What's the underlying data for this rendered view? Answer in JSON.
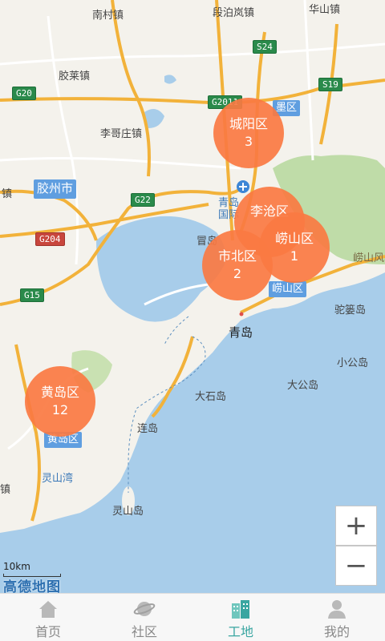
{
  "map": {
    "places": [
      {
        "id": "nancun",
        "name": "南村镇"
      },
      {
        "id": "duanbo",
        "name": "段泊岚镇"
      },
      {
        "id": "huashan",
        "name": "华山镇"
      },
      {
        "id": "jiaolai",
        "name": "胶莱镇"
      },
      {
        "id": "ligezhuang",
        "name": "李哥庄镇"
      },
      {
        "id": "zhen_left",
        "name": "镇"
      },
      {
        "id": "qingdao_airport",
        "name": "青岛 国际"
      },
      {
        "id": "mao",
        "name": "冒岛"
      },
      {
        "id": "laoshanfeng",
        "name": "崂山风"
      },
      {
        "id": "qingdao",
        "name": "青岛"
      },
      {
        "id": "tuoluodao",
        "name": "驼篓岛"
      },
      {
        "id": "xiaogongdao",
        "name": "小公岛"
      },
      {
        "id": "dagongdao",
        "name": "大公岛"
      },
      {
        "id": "dashidao",
        "name": "大石岛"
      },
      {
        "id": "liandao",
        "name": "连岛"
      },
      {
        "id": "lingshanwan",
        "name": "灵山湾"
      },
      {
        "id": "lingshandao",
        "name": "灵山岛"
      },
      {
        "id": "zhen_left2",
        "name": "镇"
      }
    ],
    "district_tags": [
      {
        "id": "jiaozhou",
        "name": "胶州市"
      },
      {
        "id": "huangdao_tag",
        "name": "黄岛区"
      },
      {
        "id": "laoshan_tag",
        "name": "崂山区"
      },
      {
        "id": "jimo_tag",
        "name": "墨区"
      }
    ],
    "road_shields": [
      {
        "id": "s24",
        "name": "S24",
        "color": "green"
      },
      {
        "id": "g20",
        "name": "G20",
        "color": "green"
      },
      {
        "id": "s19",
        "name": "S19",
        "color": "green"
      },
      {
        "id": "g2011",
        "name": "G2011",
        "color": "green"
      },
      {
        "id": "g22",
        "name": "G22",
        "color": "green"
      },
      {
        "id": "g204",
        "name": "G204",
        "color": "red"
      },
      {
        "id": "g15",
        "name": "G15",
        "color": "green"
      }
    ],
    "clusters": [
      {
        "id": "chengyang",
        "name": "城阳区",
        "count": "3"
      },
      {
        "id": "licang",
        "name": "李沧区",
        "count": ""
      },
      {
        "id": "shibei",
        "name": "市北区",
        "count": "2"
      },
      {
        "id": "laoshan",
        "name": "崂山区",
        "count": "1"
      },
      {
        "id": "huangdao",
        "name": "黄岛区",
        "count": "12"
      }
    ],
    "zoom_in": "+",
    "zoom_out": "−",
    "scale_label": "10km",
    "logo_text": "高德地图",
    "colors": {
      "cluster": "#fa7a42",
      "sea": "#a8cdea",
      "land": "#f4f2ec",
      "road_orange": "#f2b23a",
      "road_white": "#ffffff",
      "park": "#bfdca8"
    }
  },
  "tabbar": {
    "active": "worksite",
    "tabs": [
      {
        "id": "home",
        "label": "首页",
        "icon": "home-icon"
      },
      {
        "id": "community",
        "label": "社区",
        "icon": "planet-icon"
      },
      {
        "id": "worksite",
        "label": "工地",
        "icon": "buildings-icon"
      },
      {
        "id": "mine",
        "label": "我的",
        "icon": "person-icon"
      }
    ]
  }
}
